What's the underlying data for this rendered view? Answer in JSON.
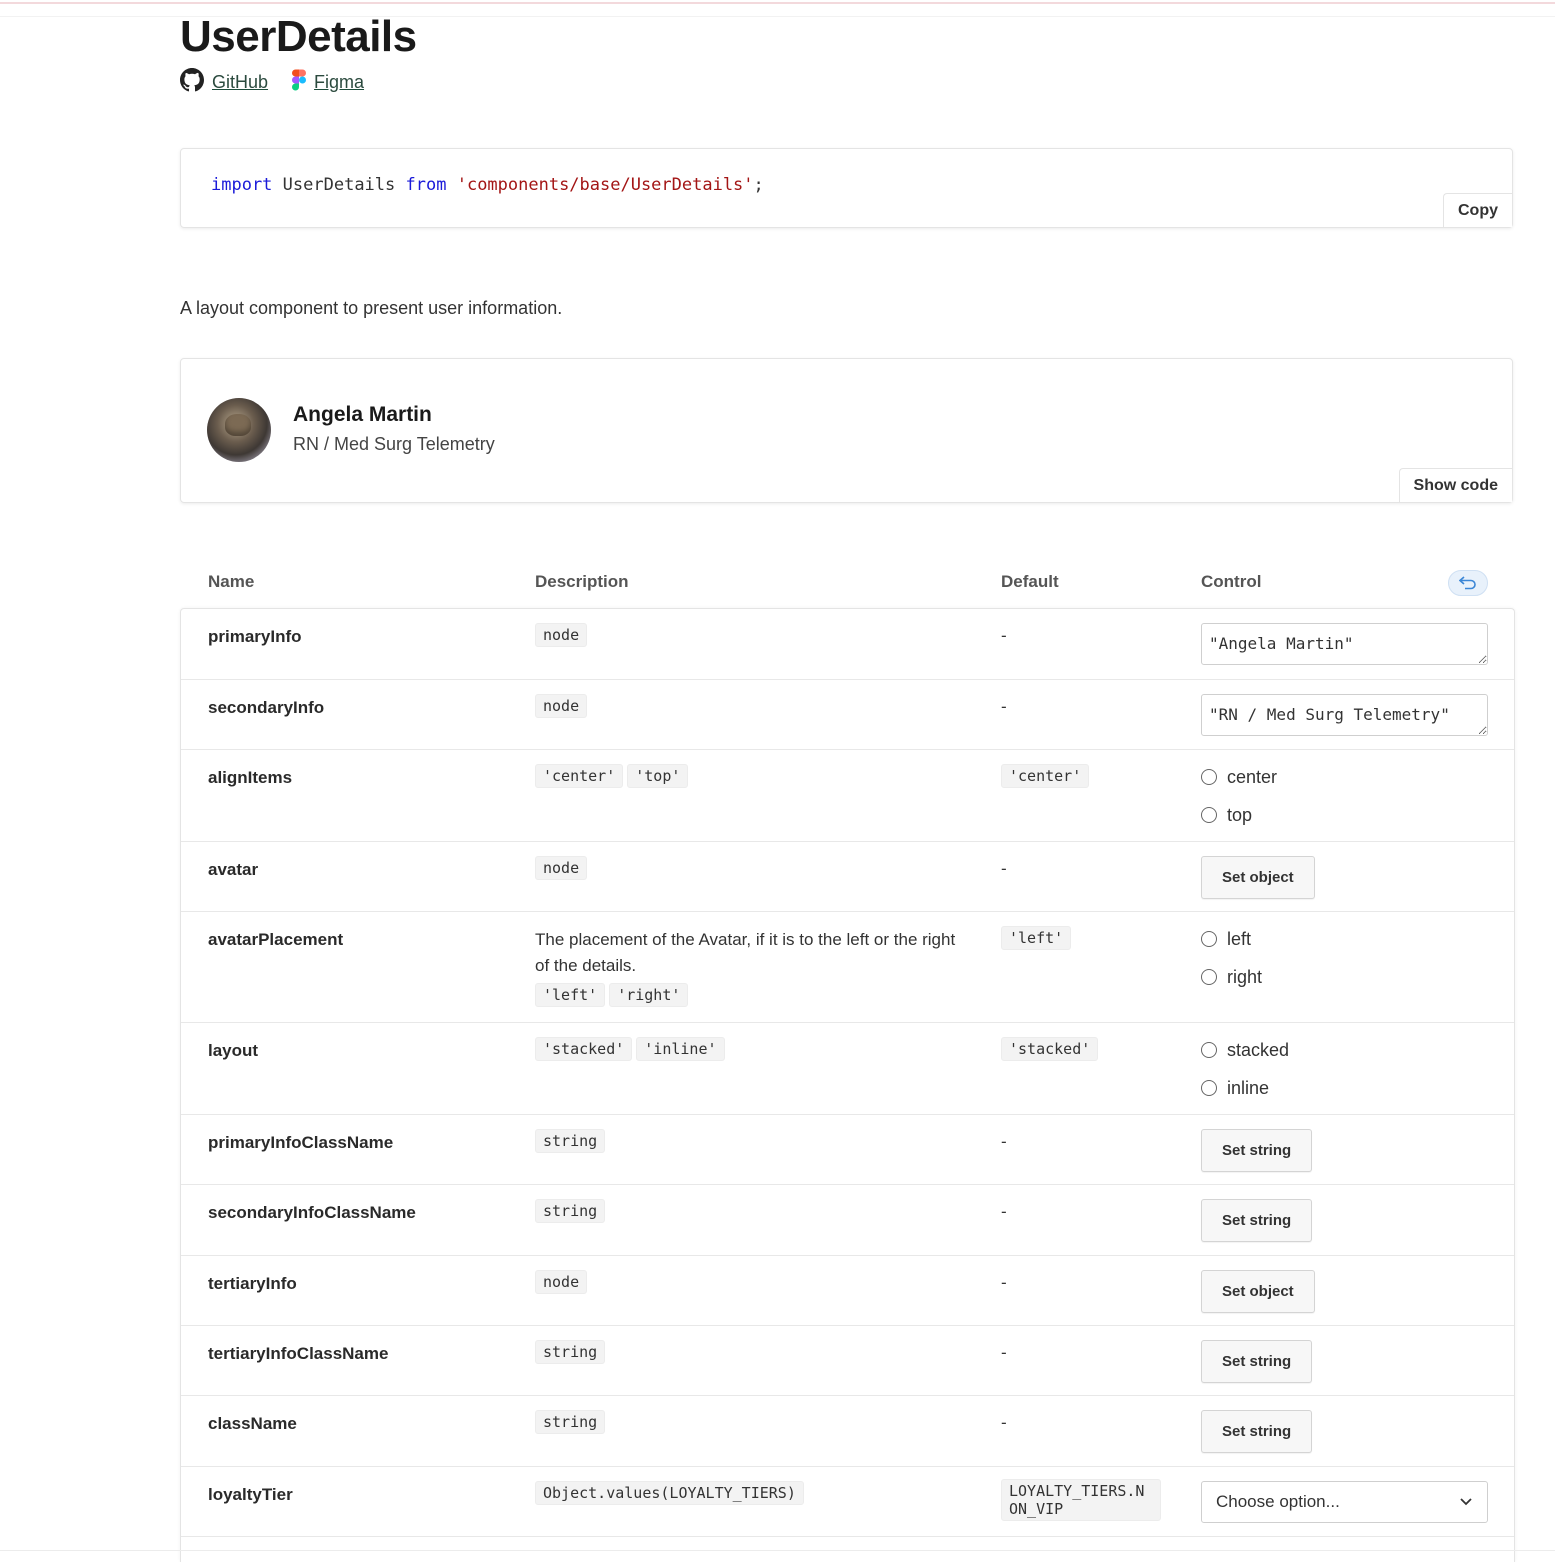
{
  "page": {
    "title": "UserDetails",
    "links": [
      {
        "label": "GitHub",
        "icon": "github-icon"
      },
      {
        "label": "Figma",
        "icon": "figma-icon"
      }
    ],
    "import_keyword": "import",
    "import_name": "UserDetails",
    "from_keyword": "from",
    "import_path": "'components/base/UserDetails'",
    "import_semicolon": ";",
    "copy_label": "Copy",
    "description": "A layout component to present user information."
  },
  "preview": {
    "primary": "Angela Martin",
    "secondary": "RN / Med Surg Telemetry",
    "show_code_label": "Show code"
  },
  "props_table": {
    "headers": [
      "Name",
      "Description",
      "Default",
      "Control"
    ],
    "rows": [
      {
        "name": "primaryInfo",
        "types": [
          "node"
        ],
        "default": "-",
        "control": "\"Angela Martin\""
      },
      {
        "name": "secondaryInfo",
        "types": [
          "node"
        ],
        "default": "-",
        "control": "\"RN / Med Surg Telemetry\""
      },
      {
        "name": "alignItems",
        "types": [
          "'center'",
          "'top'"
        ],
        "default": "'center'",
        "options": [
          "center",
          "top"
        ]
      },
      {
        "name": "avatar",
        "types": [
          "node"
        ],
        "default": "-",
        "control": "Set object"
      },
      {
        "name": "avatarPlacement",
        "text": "The placement of the Avatar, if it is to the left or the right of the details.",
        "types": [
          "'left'",
          "'right'"
        ],
        "default": "'left'",
        "options": [
          "left",
          "right"
        ]
      },
      {
        "name": "layout",
        "types": [
          "'stacked'",
          "'inline'"
        ],
        "default": "'stacked'",
        "options": [
          "stacked",
          "inline"
        ]
      },
      {
        "name": "primaryInfoClassName",
        "types": [
          "string"
        ],
        "default": "-",
        "control": "Set string"
      },
      {
        "name": "secondaryInfoClassName",
        "types": [
          "string"
        ],
        "default": "-",
        "control": "Set string"
      },
      {
        "name": "tertiaryInfo",
        "types": [
          "node"
        ],
        "default": "-",
        "control": "Set object"
      },
      {
        "name": "tertiaryInfoClassName",
        "types": [
          "string"
        ],
        "default": "-",
        "control": "Set string"
      },
      {
        "name": "className",
        "types": [
          "string"
        ],
        "default": "-",
        "control": "Set string"
      },
      {
        "name": "loyaltyTier",
        "types": [
          "Object.values(LOYALTY_TIERS)"
        ],
        "default": "LOYALTY_TIERS.NON_VIP",
        "control": "Choose option..."
      }
    ]
  }
}
